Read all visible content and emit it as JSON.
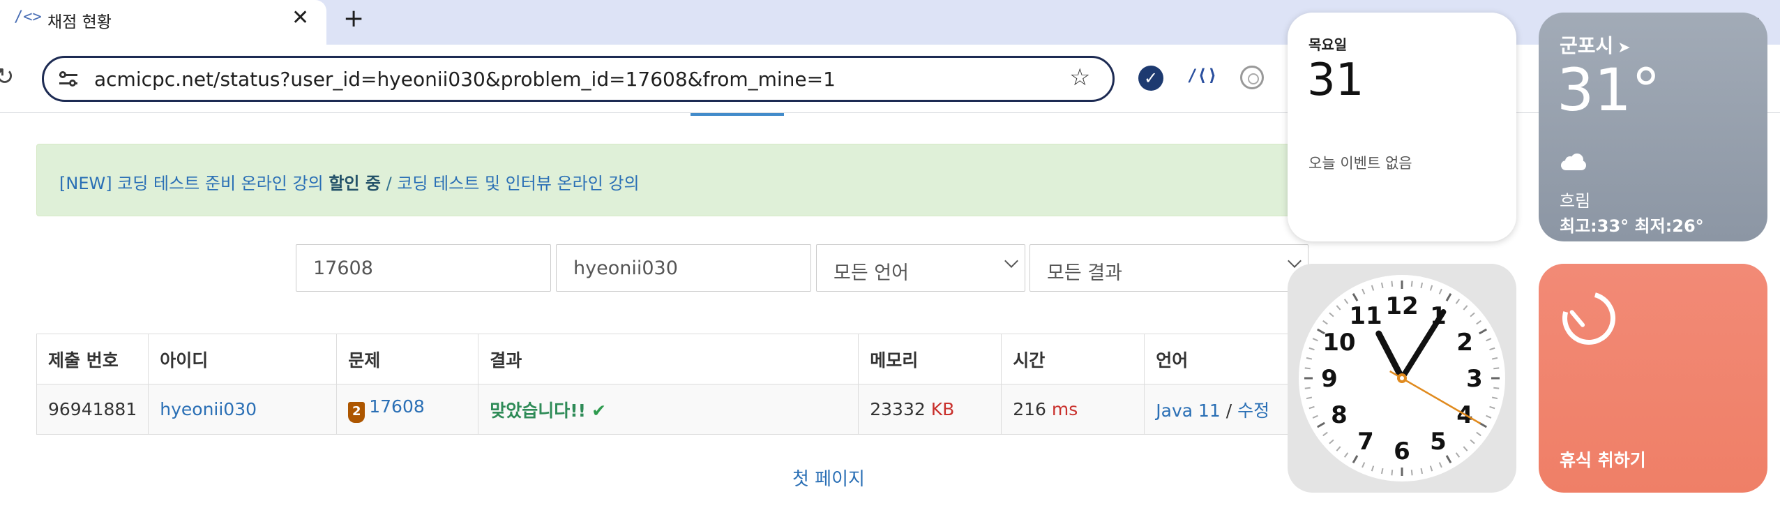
{
  "browser": {
    "tab_title": "채점 현황",
    "favicon": "/<>",
    "close_glyph": "✕",
    "new_tab_glyph": "+",
    "url": "acmicpc.net/status?user_id=hyeonii030&problem_id=17608&from_mine=1"
  },
  "notice": {
    "link1": "[NEW] 코딩 테스트 준비 온라인 강의",
    "highlight": "할인 중",
    "separator": "/",
    "link2": "코딩 테스트 및 인터뷰 온라인 강의"
  },
  "filters": {
    "problem_id": "17608",
    "user_id": "hyeonii030",
    "language": "모든 언어",
    "result": "모든 결과"
  },
  "table": {
    "headers": [
      "제출 번호",
      "아이디",
      "문제",
      "결과",
      "메모리",
      "시간",
      "언어"
    ],
    "row": {
      "submission_id": "96941881",
      "user": "hyeonii030",
      "tier": "2",
      "problem": "17608",
      "result": "맞았습니다!!",
      "check": "✔",
      "memory": "23332",
      "memory_unit": "KB",
      "time": "216",
      "time_unit": "ms",
      "language": "Java 11",
      "lang_separator": "/",
      "edit": "수정"
    }
  },
  "pagination": {
    "first_page": "첫 페이지"
  },
  "widgets": {
    "calendar": {
      "weekday": "목요일",
      "date": "31",
      "empty": "오늘 이벤트 없음"
    },
    "weather": {
      "city": "군포시",
      "arrow": "➤",
      "temp": "31°",
      "condition": "흐림",
      "range": "최고:33° 최저:26°"
    },
    "clock": {
      "numerals": [
        "12",
        "1",
        "2",
        "3",
        "4",
        "5",
        "6",
        "7",
        "8",
        "9",
        "10",
        "11"
      ],
      "hour": 11,
      "minute": 5,
      "second": 20
    },
    "timer": {
      "label": "휴식 취하기"
    }
  },
  "colors": {
    "link": "#2a6fb5",
    "success": "#2e8b57",
    "notice_bg": "#dff0d8",
    "unit_red": "#c9302c",
    "timer_bg": "#ef7f67",
    "weather_bg": "#8c96a4"
  }
}
